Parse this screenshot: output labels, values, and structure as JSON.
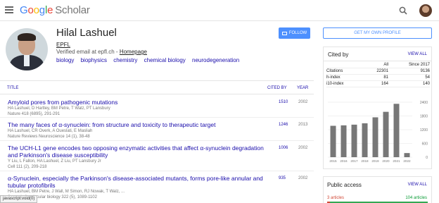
{
  "header": {
    "logo_letters": [
      "G",
      "o",
      "o",
      "g",
      "l",
      "e"
    ],
    "logo_suffix": "Scholar",
    "icons": [
      "menu-icon",
      "search-icon",
      "account-avatar"
    ]
  },
  "profile": {
    "name": "Hilal Lashuel",
    "affiliation": "EPFL",
    "verified_prefix": "Verified email at epfl.ch - ",
    "homepage_label": "Homepage",
    "interests": [
      "biology",
      "biophysics",
      "chemistry",
      "chemical biology",
      "neurodegeneration"
    ],
    "follow_label": "FOLLOW"
  },
  "table": {
    "headers": {
      "title": "TITLE",
      "cited_by": "CITED BY",
      "year": "YEAR"
    },
    "rows": [
      {
        "title": "Amyloid pores from pathogenic mutations",
        "authors": "HA Lashuel, D Hartley, BM Petre, T Walz, PT Lansbury",
        "journal": "Nature 418 (6895), 291-291",
        "cited": "1510",
        "year": "2002"
      },
      {
        "title": "The many faces of α-synuclein: from structure and toxicity to therapeutic target",
        "authors": "HA Lashuel, CR Overk, A Oueslati, E Masliah",
        "journal": "Nature Reviews Neuroscience 14 (1), 38-48",
        "cited": "1246",
        "year": "2013"
      },
      {
        "title": "The UCH-L1 gene encodes two opposing enzymatic activities that affect α-synuclein degradation and Parkinson's disease susceptibility",
        "authors": "Y Liu, L Fallon, HA Lashuel, Z Liu, PT Lansbury Jr",
        "journal": "Cell 111 (2), 209-218",
        "cited": "1006",
        "year": "2002"
      },
      {
        "title": "α-Synuclein, especially the Parkinson's disease-associated mutants, forms pore-like annular and tubular protofibrils",
        "authors": "HA Lashuel, BM Petre, J Wall, M Simon, RJ Nowak, T Walz, ...",
        "journal": "Journal of molecular biology 322 (5), 1089-1102",
        "cited": "935",
        "year": "2002"
      }
    ]
  },
  "status_tooltip": "javascript:void(0)",
  "sidebar": {
    "get_profile_label": "GET MY OWN PROFILE",
    "cited_by": {
      "title": "Cited by",
      "view_all": "VIEW ALL",
      "col_all": "All",
      "col_since": "Since 2017",
      "rows": [
        {
          "label": "Citations",
          "all": "22301",
          "since": "9136"
        },
        {
          "label": "h-index",
          "all": "81",
          "since": "54"
        },
        {
          "label": "i10-index",
          "all": "164",
          "since": "140"
        }
      ]
    },
    "public_access": {
      "title": "Public access",
      "view_all": "VIEW ALL",
      "not_available": "3 articles",
      "available": "104 articles",
      "available_fraction": 0.97
    }
  },
  "chart_data": {
    "type": "bar",
    "categories": [
      "2015",
      "2016",
      "2017",
      "2018",
      "2019",
      "2020",
      "2021",
      "2022"
    ],
    "values": [
      1370,
      1390,
      1420,
      1480,
      1740,
      1980,
      2330,
      180
    ],
    "y_ticks": [
      0,
      600,
      1200,
      1800,
      2400
    ],
    "ylim": [
      0,
      2400
    ],
    "color": "#777777"
  }
}
